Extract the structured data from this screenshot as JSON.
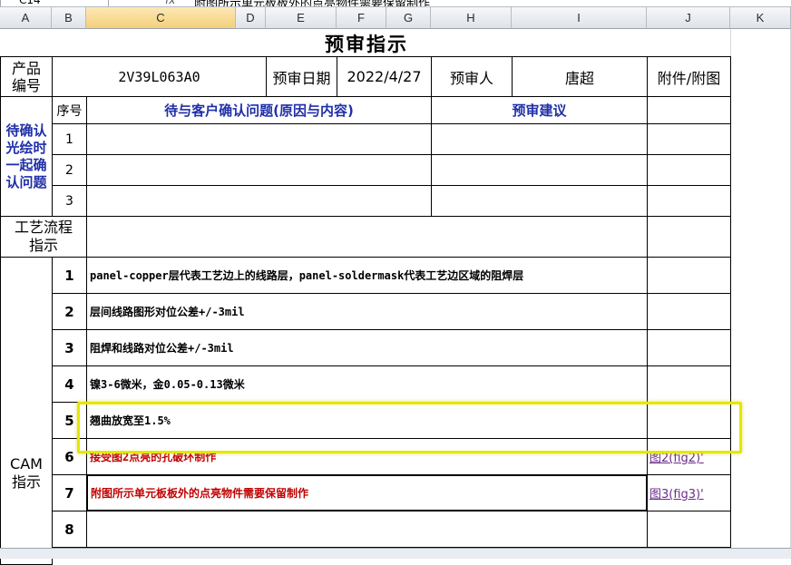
{
  "formula_bar": {
    "name_box": "C14",
    "fx": "fx",
    "content": "附图所示单元板板外的点亮物件需要保留制作"
  },
  "columns": [
    "A",
    "B",
    "C",
    "D",
    "E",
    "F",
    "G",
    "H",
    "I",
    "J",
    "K"
  ],
  "sheet": {
    "title": "预审指示",
    "row_product": {
      "label": "产品\n编号",
      "product_no": "2V39L063A0",
      "date_label": "预审日期",
      "date": "2022/4/27",
      "reviewer_label": "预审人",
      "reviewer": "唐超",
      "attach_label": "附件/附图"
    },
    "pending": {
      "label": "待确认\n光绘时\n一起确\n认问题",
      "seq_header": "序号",
      "question_header": "待与客户确认问题(原因与内容)",
      "suggest_header": "预审建议",
      "rows": [
        "1",
        "2",
        "3"
      ]
    },
    "process": {
      "label": "工艺流程\n指示"
    },
    "cam": {
      "label": "CAM\n指示",
      "rows": [
        {
          "no": "1",
          "text": "panel-copper层代表工艺边上的线路层，panel-soldermask代表工艺边区域的阻焊层",
          "attach": ""
        },
        {
          "no": "2",
          "text": "层间线路图形对位公差+/-3mil",
          "attach": ""
        },
        {
          "no": "3",
          "text": "阻焊和线路对位公差+/-3mil",
          "attach": ""
        },
        {
          "no": "4",
          "text": "镍3-6微米，金0.05-0.13微米",
          "attach": ""
        },
        {
          "no": "5",
          "text": "翘曲放宽至1.5%",
          "attach": ""
        },
        {
          "no": "6",
          "text": "接受图2点亮的孔破环制作",
          "attach": "图2(fig2)'"
        },
        {
          "no": "7",
          "text": "附图所示单元板板外的点亮物件需要保留制作",
          "attach": "图3(fig3)'"
        },
        {
          "no": "8",
          "text": "",
          "attach": ""
        }
      ]
    }
  },
  "colors": {
    "red_text": "#c00000",
    "blue_header": "#1f2fa8",
    "highlight": "#e6e600",
    "link": "#6b2b8a"
  }
}
